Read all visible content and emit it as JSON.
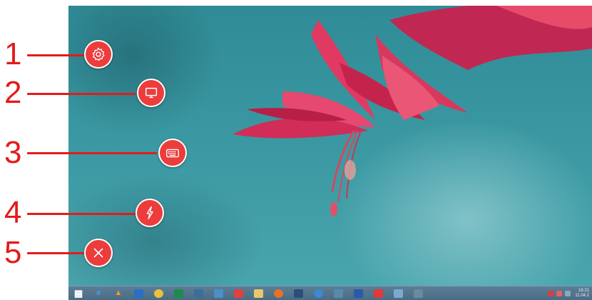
{
  "annotations": [
    {
      "number": "1",
      "target": "settings"
    },
    {
      "number": "2",
      "target": "display"
    },
    {
      "number": "3",
      "target": "keyboard"
    },
    {
      "number": "4",
      "target": "power"
    },
    {
      "number": "5",
      "target": "close"
    }
  ],
  "buttons": [
    {
      "name": "settings-button",
      "icon": "gear-icon"
    },
    {
      "name": "display-button",
      "icon": "monitor-icon"
    },
    {
      "name": "keyboard-button",
      "icon": "keyboard-icon"
    },
    {
      "name": "power-button",
      "icon": "lightning-bolt-icon"
    },
    {
      "name": "close-button",
      "icon": "close-icon"
    }
  ],
  "colors": {
    "annotation_red": "#e31b1b",
    "button_red": "#ec3c3c",
    "button_border": "#ffffff",
    "taskbar": "#4a6c84"
  },
  "taskbar": {
    "items": [
      "windows-start-icon",
      "internet-explorer-icon",
      "vlc-icon",
      "outlook-icon",
      "chrome-icon",
      "excel-icon",
      "network-icon",
      "pen-tool-icon",
      "calendar-app-icon",
      "file-explorer-icon",
      "firefox-icon",
      "ftp-client-icon",
      "remote-desktop-icon",
      "paint-icon",
      "word-icon",
      "media-icon",
      "monitor-app-icon",
      "chart-app-icon"
    ],
    "clock_time": "16:21",
    "clock_date": "11.04.2"
  }
}
